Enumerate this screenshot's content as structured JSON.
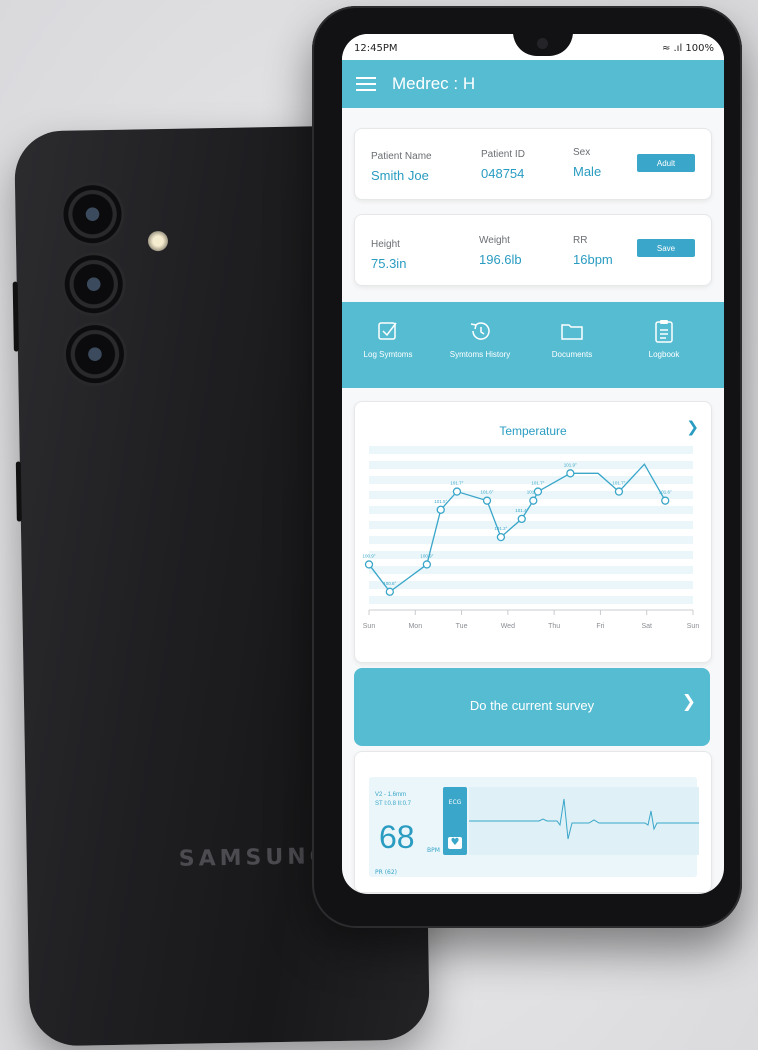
{
  "device": {
    "brand": "SAMSUNG"
  },
  "status_bar": {
    "time": "12:45PM",
    "signal": "≈ .ıl 100%"
  },
  "app_bar": {
    "title": "Medrec : H"
  },
  "patient_card": {
    "fields": [
      {
        "label": "Patient Name",
        "value": "Smith Joe"
      },
      {
        "label": "Patient ID",
        "value": "048754"
      },
      {
        "label": "Sex",
        "value": "Male"
      }
    ],
    "button_label": "Adult"
  },
  "vitals_card": {
    "fields": [
      {
        "label": "Height",
        "value": "75.3in"
      },
      {
        "label": "Weight",
        "value": "196.6lb"
      },
      {
        "label": "RR",
        "value": "16bpm"
      }
    ],
    "button_label": "Save"
  },
  "nav": [
    {
      "label": "Log Symtoms",
      "icon": "checkbox-icon"
    },
    {
      "label": "Symtoms History",
      "icon": "history-icon"
    },
    {
      "label": "Documents",
      "icon": "folder-icon"
    },
    {
      "label": "Logbook",
      "icon": "clipboard-icon"
    }
  ],
  "chart_card": {
    "title": "Temperature",
    "chart_data": {
      "type": "line",
      "title": "Temperature",
      "categories": [
        "Sun",
        "Mon",
        "Tue",
        "Wed",
        "Thu",
        "Fri",
        "Sat",
        "Sun"
      ],
      "x": [
        0,
        0.45,
        1.25,
        1.55,
        1.9,
        2.55,
        2.85,
        3.3,
        3.55,
        3.65,
        4.35,
        4.95,
        5.4,
        5.95,
        6.4
      ],
      "values": [
        100.9,
        100.6,
        100.9,
        101.5,
        101.7,
        101.6,
        101.2,
        101.4,
        101.6,
        101.7,
        101.9,
        101.9,
        101.7,
        102.0,
        101.6
      ],
      "labels": [
        "100.9°",
        "100.6°",
        "100.9°",
        "101.5°",
        "101.7°",
        "101.6°",
        "101.2°",
        "101.4°",
        "101.6°",
        "101.7°",
        "101.9°",
        "",
        "101.7°",
        "",
        "101.6°"
      ],
      "marker_shown": [
        true,
        true,
        true,
        true,
        true,
        true,
        true,
        true,
        true,
        true,
        true,
        false,
        true,
        false,
        true
      ],
      "xlabel": "",
      "ylabel": "",
      "grid": true,
      "colors": {
        "line": "#3aa6c9",
        "band": "#eaf6f9"
      }
    }
  },
  "survey": {
    "label": "Do the current survey"
  },
  "ecg": {
    "lead_text": [
      "V2 - 1.6mm",
      "ST I:0.8  II:0.7"
    ],
    "bpm": "68",
    "bpm_unit": "BPM",
    "pr": "PR (62)",
    "tag": "ECG"
  },
  "colors": {
    "accent": "#56bcd2",
    "accent_dark": "#2a9cc1"
  }
}
